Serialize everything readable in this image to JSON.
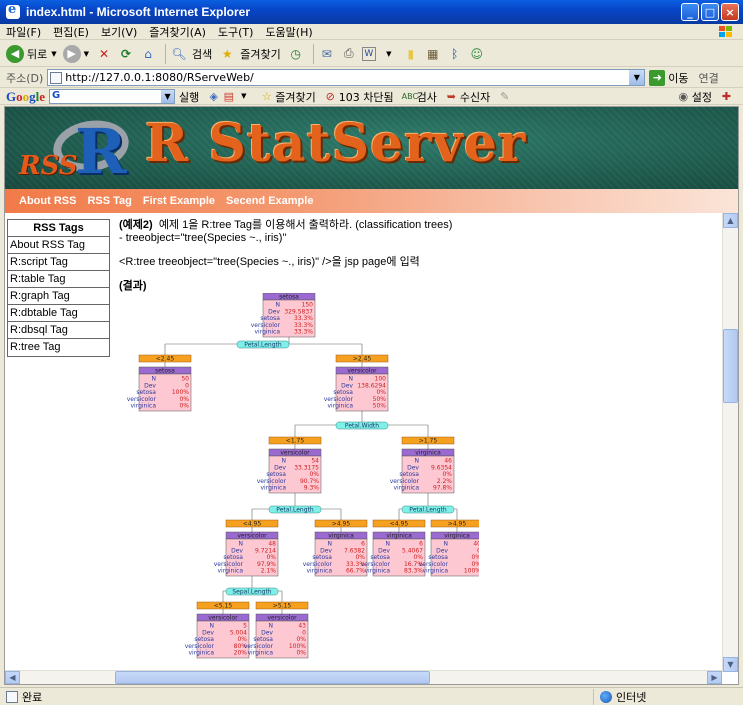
{
  "window": {
    "title": "index.html - Microsoft Internet Explorer",
    "min": "_",
    "max": "□",
    "close": "×"
  },
  "menu": [
    "파일(F)",
    "편집(E)",
    "보기(V)",
    "즐겨찾기(A)",
    "도구(T)",
    "도움말(H)"
  ],
  "toolbar": {
    "back": "뒤로",
    "search": "검색",
    "favorites": "즐겨찾기"
  },
  "address": {
    "label": "주소(D)",
    "url": "http://127.0.0.1:8080/RServeWeb/",
    "go": "이동",
    "links": "연결"
  },
  "google": {
    "search_icon": "G",
    "items": [
      "실행",
      "즐겨찾기",
      "103 차단됨",
      "검사",
      "수신자",
      "설정"
    ]
  },
  "banner": {
    "small": "RSS",
    "r": "R",
    "title": "R StatServer"
  },
  "nav": [
    "About RSS",
    "RSS Tag",
    "First Example",
    "Secend Example"
  ],
  "sidebar": {
    "heading": "RSS Tags",
    "items": [
      "About RSS Tag",
      "R:script Tag",
      "R:table Tag",
      "R:graph Tag",
      "R:dbtable Tag",
      "R:dbsql Tag",
      "R:tree Tag"
    ]
  },
  "content": {
    "example_label": "(예제2)",
    "line1": "예제 1을 R:tree Tag를 이용해서 출력하라. (classification trees)",
    "line2": "- treeobject=\"tree(Species ~., iris)\"",
    "line3": "<R:tree treeobject=\"tree(Species ~., iris)\" />을 jsp page에 입력",
    "result_label": "(결과)"
  },
  "tree": {
    "row_labels": [
      "N",
      "Dev",
      "setosa",
      "versicolor",
      "virginica"
    ],
    "nodes": [
      {
        "id": "root",
        "class": "setosa",
        "values": [
          "150",
          "329.5837",
          "33.3%",
          "33.3%",
          "33.3%"
        ]
      },
      {
        "id": "n2",
        "class": "setosa",
        "values": [
          "50",
          "0",
          "100%",
          "0%",
          "0%"
        ]
      },
      {
        "id": "n3",
        "class": "versicolor",
        "values": [
          "100",
          "138.6294",
          "0%",
          "50%",
          "50%"
        ]
      },
      {
        "id": "n6",
        "class": "versicolor",
        "values": [
          "54",
          "33.3175",
          "0%",
          "90.7%",
          "9.3%"
        ]
      },
      {
        "id": "n7",
        "class": "virginica",
        "values": [
          "46",
          "9.6354",
          "0%",
          "2.2%",
          "97.8%"
        ]
      },
      {
        "id": "n12",
        "class": "versicolor",
        "values": [
          "48",
          "9.7214",
          "0%",
          "97.9%",
          "2.1%"
        ]
      },
      {
        "id": "n13",
        "class": "virginica",
        "values": [
          "6",
          "7.6382",
          "0%",
          "33.3%",
          "66.7%"
        ]
      },
      {
        "id": "n14",
        "class": "virginica",
        "values": [
          "6",
          "5.4067",
          "0%",
          "16.7%",
          "83.3%"
        ]
      },
      {
        "id": "n15",
        "class": "virginica",
        "values": [
          "40",
          "0",
          "0%",
          "0%",
          "100%"
        ]
      },
      {
        "id": "n24",
        "class": "versicolor",
        "values": [
          "5",
          "5.004",
          "0%",
          "80%",
          "20%"
        ]
      },
      {
        "id": "n25",
        "class": "versicolor",
        "values": [
          "43",
          "0",
          "0%",
          "100%",
          "0%"
        ]
      }
    ],
    "splits": [
      {
        "id": "s1",
        "label": "Petal.Length",
        "left": "<2.45",
        "right": ">2.45"
      },
      {
        "id": "s3",
        "label": "Petal.Width",
        "left": "<1.75",
        "right": ">1.75"
      },
      {
        "id": "s6",
        "label": "Petal.Length",
        "left": "<4.95",
        "right": ">4.95"
      },
      {
        "id": "s7",
        "label": "Petal.Length",
        "left": "<4.95",
        "right": ">4.95"
      },
      {
        "id": "s12",
        "label": "Sepal.Length",
        "left": "<5.15",
        "right": ">5.15"
      }
    ]
  },
  "status": {
    "text": "완료",
    "zone": "인터넷"
  },
  "colors": {
    "node_header": "#9a6ad0",
    "node_body": "#fdc8d2",
    "split_label": "#7ef0e8",
    "branch_label": "#f6a020"
  }
}
